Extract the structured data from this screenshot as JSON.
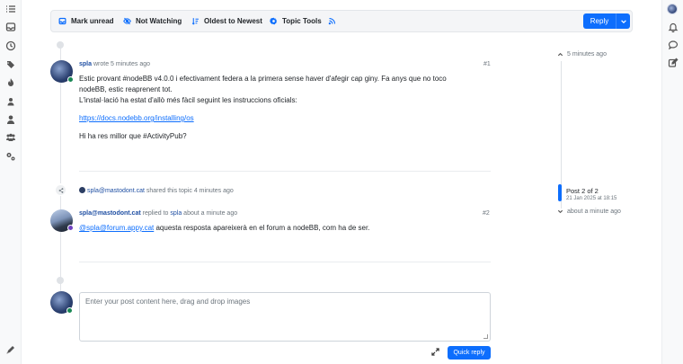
{
  "toolbar": {
    "mark_unread": "Mark unread",
    "watching": "Not Watching",
    "sort": "Oldest to Newest",
    "tools": "Topic Tools",
    "reply": "Reply"
  },
  "posts": [
    {
      "user": "spla",
      "action": "wrote",
      "time": "5 minutes ago",
      "number": "#1",
      "body": {
        "line1": "Estic provant #nodeBB v4.0.0 i efectivament federa a la primera sense haver d'afegir cap giny. Fa anys que no toco",
        "line2": "nodeBB, estic reaprenent tot.",
        "line3": "L'instal·lació ha estat d'allò més fàcil seguint les instruccions oficials:",
        "link": "https://docs.nodebb.org/installing/os",
        "line4": "Hi ha res millor que #ActivityPub?"
      }
    },
    {
      "user": "spla@mastodont.cat",
      "action": "replied to",
      "target": "spla",
      "time": "about a minute ago",
      "number": "#2",
      "body": {
        "mention": "@spla@forum.appy.cat",
        "text": " aquesta resposta apareixerà en el forum a nodeBB, com ha de ser."
      }
    }
  ],
  "event": {
    "user": "spla@mastodont.cat",
    "text": "shared this topic",
    "time": "4 minutes ago"
  },
  "composer": {
    "placeholder": "Enter your post content here, drag and drop images",
    "quick_reply": "Quick reply"
  },
  "pagination": {
    "top_time": "5 minutes ago",
    "label": "Post 2 of 2",
    "date": "21 Jan 2025 at 18:15",
    "bottom_time": "about a minute ago"
  },
  "colors": {
    "accent": "#0d6efd",
    "online": "#198754",
    "username": "#1f4fa3"
  }
}
